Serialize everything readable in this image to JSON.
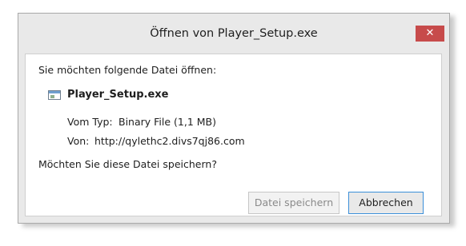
{
  "dialog": {
    "title": "Öffnen von Player_Setup.exe",
    "close_symbol": "✕",
    "prompt": "Sie möchten folgende Datei öffnen:",
    "file_icon": "application-file-icon",
    "file_name": "Player_Setup.exe",
    "type_label": "Vom Typ:",
    "type_value": "Binary File (1,1 MB)",
    "from_label": "Von:",
    "from_value": "http://qylethc2.divs7qj86.com",
    "question": "Möchten Sie diese Datei speichern?",
    "save_label": "Datei speichern",
    "save_enabled": false,
    "cancel_label": "Abbrechen"
  },
  "colors": {
    "close_button": "#c74b4b",
    "focus_border": "#3b8fd9",
    "window_bg": "#e9e9e9",
    "content_bg": "#ffffff"
  }
}
